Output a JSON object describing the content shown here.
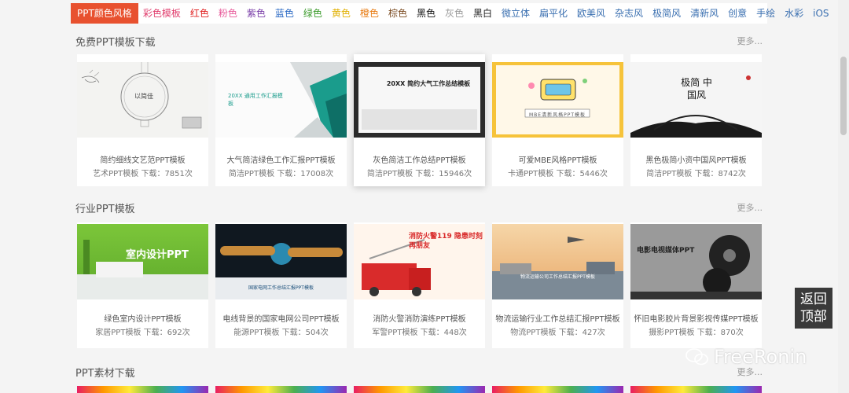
{
  "colornav": [
    {
      "label": "PPT颜色风格",
      "color": "#ffffff"
    },
    {
      "label": "彩色模板",
      "color": "#e03b6b"
    },
    {
      "label": "红色",
      "color": "#e02020"
    },
    {
      "label": "粉色",
      "color": "#e85a9a"
    },
    {
      "label": "紫色",
      "color": "#7a3ea8"
    },
    {
      "label": "蓝色",
      "color": "#2a69c4"
    },
    {
      "label": "绿色",
      "color": "#3a9a2a"
    },
    {
      "label": "黄色",
      "color": "#e0b000"
    },
    {
      "label": "橙色",
      "color": "#e87a10"
    },
    {
      "label": "棕色",
      "color": "#7a4a20"
    },
    {
      "label": "黑色",
      "color": "#111111"
    },
    {
      "label": "灰色",
      "color": "#999999"
    },
    {
      "label": "黑白",
      "color": "#222222"
    },
    {
      "label": "微立体",
      "color": "#3a6fb0"
    },
    {
      "label": "扁平化",
      "color": "#3a6fb0"
    },
    {
      "label": "欧美风",
      "color": "#3a6fb0"
    },
    {
      "label": "杂志风",
      "color": "#3a6fb0"
    },
    {
      "label": "极简风",
      "color": "#3a6fb0"
    },
    {
      "label": "清新风",
      "color": "#3a6fb0"
    },
    {
      "label": "创意",
      "color": "#3a6fb0"
    },
    {
      "label": "手绘",
      "color": "#3a6fb0"
    },
    {
      "label": "水彩",
      "color": "#3a6fb0"
    },
    {
      "label": "iOS",
      "color": "#3a6fb0"
    }
  ],
  "sections": [
    {
      "title": "免费PPT模板下载",
      "more": "更多...",
      "cards": [
        {
          "name": "简约细线文艺范PPT模板",
          "meta": "艺术PPT模板  下载：7851次",
          "thumb_text": "以简佳"
        },
        {
          "name": "大气简洁绿色工作汇报PPT模板",
          "meta": "简洁PPT模板  下载：17008次",
          "thumb_text": "20XX 通用工作汇报模板"
        },
        {
          "name": "灰色简洁工作总结PPT模板",
          "meta": "简洁PPT模板  下载：15946次",
          "thumb_text": "20XX 简约大气工作总结模板"
        },
        {
          "name": "可爱MBE风格PPT模板",
          "meta": "卡通PPT模板  下载：5446次",
          "thumb_text": "MBE清新风格PPT模板"
        },
        {
          "name": "黑色极简小资中国风PPT模板",
          "meta": "简洁PPT模板  下载：8742次",
          "thumb_text": "极简 中国风"
        }
      ]
    },
    {
      "title": "行业PPT模板",
      "more": "更多...",
      "cards": [
        {
          "name": "绿色室内设计PPT模板",
          "meta": "家居PPT模板  下载：692次",
          "thumb_text": "室内设计PPT"
        },
        {
          "name": "电线背景的国家电网公司PPT模板",
          "meta": "能源PPT模板  下载：504次",
          "thumb_text": "国家电网工作总结汇报PPT模板"
        },
        {
          "name": "消防火警消防演练PPT模板",
          "meta": "军警PPT模板  下载：448次",
          "thumb_text": "消防火警119 隐患时刻再朋友"
        },
        {
          "name": "物流运输行业工作总结汇报PPT模板",
          "meta": "物流PPT模板  下载：427次",
          "thumb_text": "物流运输公司工作总结汇报PPT模板"
        },
        {
          "name": "怀旧电影胶片背景影视传媒PPT模板",
          "meta": "摄影PPT模板  下载：870次",
          "thumb_text": "电影电视媒体PPT"
        }
      ]
    },
    {
      "title": "PPT素材下载",
      "more": "更多..."
    }
  ],
  "backtop": {
    "line1": "返回",
    "line2": "顶部"
  },
  "watermark": "FreeRonin"
}
